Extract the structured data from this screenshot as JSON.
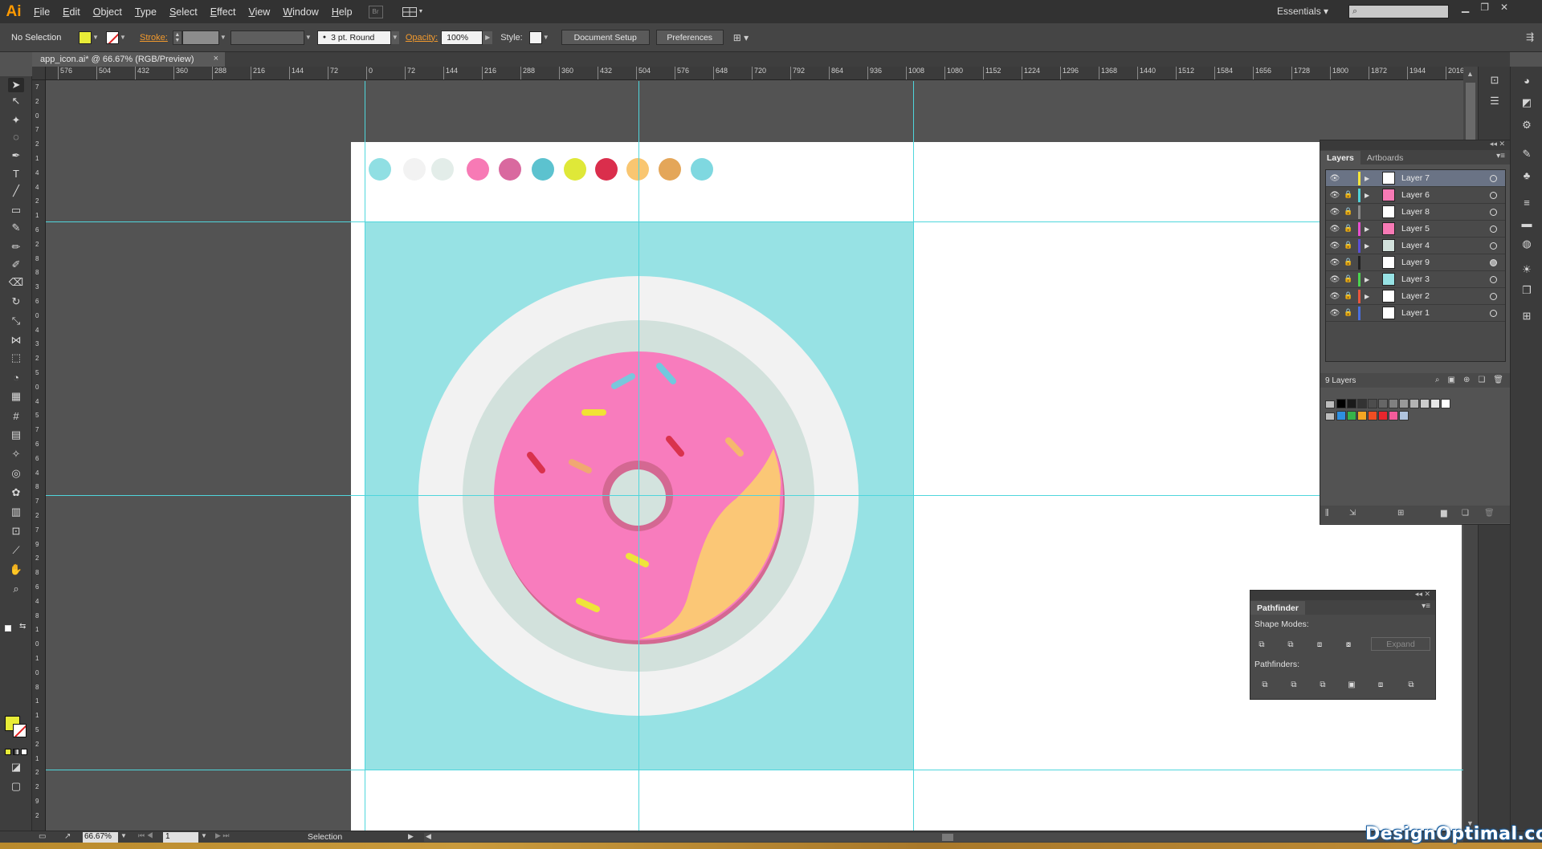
{
  "app": {
    "logo": "Ai",
    "workspace": "Essentials ▾"
  },
  "menu": [
    "File",
    "Edit",
    "Object",
    "Type",
    "Select",
    "Effect",
    "View",
    "Window",
    "Help"
  ],
  "menubar_icons": {
    "bridge": "Br",
    "arrange": "arrange-documents-icon"
  },
  "window_controls": [
    "▁",
    "❐",
    "✕"
  ],
  "control_bar": {
    "selection": "No Selection",
    "stroke_label": "Stroke:",
    "brush": "3 pt. Round",
    "opacity_label": "Opacity:",
    "opacity_value": "100%",
    "style_label": "Style:",
    "document_setup": "Document Setup",
    "preferences": "Preferences",
    "fill_color": "#e8ec38"
  },
  "document": {
    "tab_title": "app_icon.ai* @ 66.67% (RGB/Preview)",
    "close": "×"
  },
  "ruler": {
    "h_labels": [
      "576",
      "504",
      "432",
      "360",
      "288",
      "216",
      "144",
      "72",
      "0",
      "72",
      "144",
      "216",
      "288",
      "360",
      "432",
      "504",
      "576",
      "648",
      "720",
      "792",
      "864",
      "936",
      "1008",
      "1080",
      "1152",
      "1224",
      "1296",
      "1368",
      "1440",
      "1512",
      "1584",
      "1656",
      "1728",
      "1800",
      "1872",
      "1944",
      "2016"
    ],
    "v_labels": [
      "7",
      "2",
      "0",
      "7",
      "2",
      "1",
      "4",
      "4",
      "2",
      "1",
      "6",
      "2",
      "8",
      "8",
      "3",
      "6",
      "0",
      "4",
      "3",
      "2",
      "5",
      "0",
      "4",
      "5",
      "7",
      "6",
      "6",
      "4",
      "8",
      "7",
      "2",
      "7",
      "9",
      "2",
      "8",
      "6",
      "4",
      "8",
      "1",
      "0",
      "1",
      "0",
      "8",
      "1",
      "1",
      "5",
      "2",
      "1",
      "2",
      "2",
      "9",
      "2"
    ]
  },
  "palette_colors": [
    "#90dfe3",
    "#f2f2f2",
    "#e3ede9",
    "#f77ab5",
    "#d9699f",
    "#5cc2cf",
    "#dfe838",
    "#da2e4c",
    "#f9c671",
    "#e4a659",
    "#7fd8e0"
  ],
  "artwork": {
    "background": "#97e2e4",
    "plate_outer": "#f2f2f2",
    "plate_inner": "#d2e1dc",
    "donut_shadow": "#d46892",
    "donut_frosting": "#f87cbd",
    "donut_dough": "#fbc776",
    "hole_ring": "#d46892",
    "hole": "#d3e3de",
    "sprinkle_colors": [
      "#79c7dc",
      "#71c9de",
      "#f1e235",
      "#d9324d",
      "#d9324d",
      "#f5b76e",
      "#f0a872",
      "#efe43a",
      "#efe43a"
    ]
  },
  "layers_panel": {
    "tabs": [
      "Layers",
      "Artboards"
    ],
    "count": "9 Layers",
    "layers": [
      {
        "name": "Layer 7",
        "color": "#f5e53a",
        "expand": true,
        "locked": false,
        "selected": true,
        "target_filled": false,
        "thumb": "#ffffff"
      },
      {
        "name": "Layer 6",
        "color": "#4fd1d8",
        "expand": true,
        "locked": true,
        "selected": false,
        "target_filled": false,
        "thumb": "#f77ab5"
      },
      {
        "name": "Layer 8",
        "color": "#8a8a8a",
        "expand": false,
        "locked": true,
        "selected": false,
        "target_filled": false,
        "thumb": "#ffffff"
      },
      {
        "name": "Layer 5",
        "color": "#e84fd0",
        "expand": true,
        "locked": true,
        "selected": false,
        "target_filled": false,
        "thumb": "#f77ab5"
      },
      {
        "name": "Layer 4",
        "color": "#5b4fd6",
        "expand": true,
        "locked": true,
        "selected": false,
        "target_filled": false,
        "thumb": "#d2e1dc"
      },
      {
        "name": "Layer 9",
        "color": "#222222",
        "expand": false,
        "locked": true,
        "selected": false,
        "target_filled": true,
        "thumb": "#ffffff"
      },
      {
        "name": "Layer 3",
        "color": "#4bd44f",
        "expand": true,
        "locked": true,
        "selected": false,
        "target_filled": false,
        "thumb": "#97e2e4"
      },
      {
        "name": "Layer 2",
        "color": "#e8553e",
        "expand": true,
        "locked": true,
        "selected": false,
        "target_filled": false,
        "thumb": "#ffffff"
      },
      {
        "name": "Layer 1",
        "color": "#4a6fe0",
        "expand": false,
        "locked": true,
        "selected": false,
        "target_filled": false,
        "thumb": "#ffffff"
      }
    ]
  },
  "swatches": {
    "grays": [
      "#000000",
      "#1a1a1a",
      "#333333",
      "#4d4d4d",
      "#666666",
      "#808080",
      "#999999",
      "#b3b3b3",
      "#cccccc",
      "#e6e6e6",
      "#ffffff"
    ],
    "colors": [
      "#2e8fe0",
      "#36b34a",
      "#f5a623",
      "#f04e23",
      "#e8262d",
      "#f45b9a",
      "#b0c4de"
    ]
  },
  "pathfinder": {
    "title": "Pathfinder",
    "shape_modes_label": "Shape Modes:",
    "pathfinders_label": "Pathfinders:",
    "expand": "Expand"
  },
  "status": {
    "zoom": "66.67%",
    "page": "1",
    "tool": "Selection"
  },
  "watermark": "DesignOptimal.com"
}
